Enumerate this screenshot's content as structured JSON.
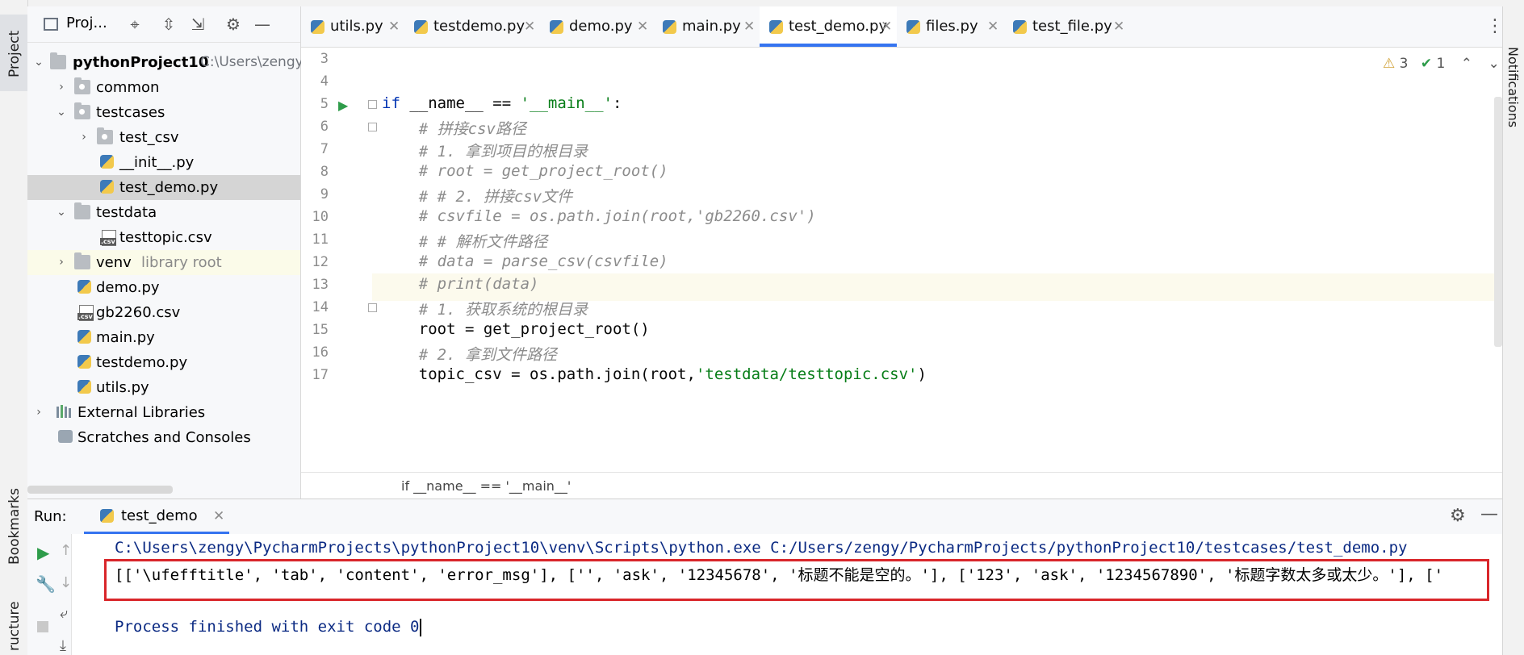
{
  "left_strip": {
    "project_tab": "Project",
    "bookmarks_tab": "Bookmarks",
    "structure_tab": "ructure"
  },
  "project_panel": {
    "title": "Proj...",
    "tree": [
      {
        "label": "pythonProject10",
        "hint": "C:\\Users\\zengy\\",
        "type": "folder",
        "expanded": true
      },
      {
        "label": "common",
        "type": "package",
        "expanded": false
      },
      {
        "label": "testcases",
        "type": "package",
        "expanded": true
      },
      {
        "label": "test_csv",
        "type": "package",
        "expanded": false
      },
      {
        "label": "__init__.py",
        "type": "py"
      },
      {
        "label": "test_demo.py",
        "type": "py",
        "selected": true
      },
      {
        "label": "testdata",
        "type": "folder",
        "expanded": true
      },
      {
        "label": "testtopic.csv",
        "type": "csv"
      },
      {
        "label": "venv",
        "hint": "library root",
        "type": "folder",
        "expanded": false
      },
      {
        "label": "demo.py",
        "type": "py"
      },
      {
        "label": "gb2260.csv",
        "type": "csv"
      },
      {
        "label": "main.py",
        "type": "py"
      },
      {
        "label": "testdemo.py",
        "type": "py"
      },
      {
        "label": "utils.py",
        "type": "py"
      },
      {
        "label": "External Libraries",
        "type": "lib",
        "expanded": false
      },
      {
        "label": "Scratches and Consoles",
        "type": "scratch"
      }
    ]
  },
  "editor_tabs": [
    {
      "label": "utils.py"
    },
    {
      "label": "testdemo.py"
    },
    {
      "label": "demo.py"
    },
    {
      "label": "main.py"
    },
    {
      "label": "test_demo.py",
      "active": true
    },
    {
      "label": "files.py"
    },
    {
      "label": "test_file.py"
    }
  ],
  "inspections": {
    "warnings": "3",
    "weak_warnings": "1"
  },
  "editor": {
    "lines": [
      {
        "n": "3",
        "text": ""
      },
      {
        "n": "4",
        "text": ""
      },
      {
        "n": "5",
        "kw": "if",
        "rest": " __name__ == ",
        "str": "'__main__'",
        "tail": ":"
      },
      {
        "n": "6",
        "comment": "    # 拼接csv路径"
      },
      {
        "n": "7",
        "comment": "    # 1. 拿到项目的根目录"
      },
      {
        "n": "8",
        "comment": "    # root = get_project_root()"
      },
      {
        "n": "9",
        "comment": "    # # 2. 拼接csv文件"
      },
      {
        "n": "10",
        "comment": "    # csvfile = os.path.join(root,'gb2260.csv')"
      },
      {
        "n": "11",
        "comment": "    # # 解析文件路径"
      },
      {
        "n": "12",
        "comment": "    # data = parse_csv(csvfile)"
      },
      {
        "n": "13",
        "comment": "    # print(data)"
      },
      {
        "n": "14",
        "comment": "    # 1. 获取系统的根目录"
      },
      {
        "n": "15",
        "text": "    root = get_project_root()"
      },
      {
        "n": "16",
        "comment": "    # 2. 拿到文件路径"
      },
      {
        "n": "17",
        "pre": "    topic_csv = os.path.join(root,",
        "str": "'testdata/testtopic.csv'",
        "tail": ")"
      }
    ],
    "breadcrumb": "if __name__ == '__main__'"
  },
  "run_panel": {
    "label": "Run:",
    "tab": "test_demo",
    "console": {
      "command": "C:\\Users\\zengy\\PycharmProjects\\pythonProject10\\venv\\Scripts\\python.exe C:/Users/zengy/PycharmProjects/pythonProject10/testcases/test_demo.py",
      "output": "[['\\ufefftitle', 'tab', 'content', 'error_msg'], ['', 'ask', '12345678', '标题不能是空的。'], ['123', 'ask', '1234567890', '标题字数太多或太少。'], ['",
      "finish": "Process finished with exit code 0"
    }
  },
  "right_strip": {
    "notifications_tab": "Notifications"
  }
}
